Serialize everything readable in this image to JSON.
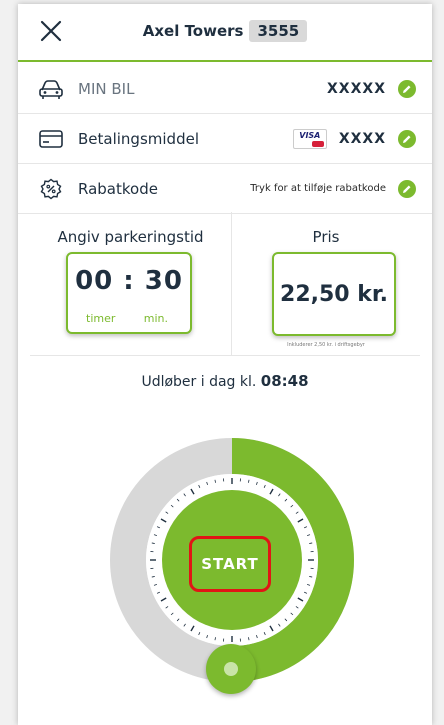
{
  "header": {
    "title": "Axel Towers",
    "zone": "3555",
    "icon": "close-icon"
  },
  "rows": {
    "car": {
      "label": "MIN BIL",
      "value": "XXXXX",
      "icon": "car-icon"
    },
    "payment": {
      "label": "Betalingsmiddel",
      "card_brand": "VISA",
      "value": "XXXX",
      "icon": "credit-card-icon"
    },
    "discount": {
      "label": "Rabatkode",
      "hint": "Tryk for at tilføje rabatkode",
      "icon": "discount-badge-icon"
    }
  },
  "duration": {
    "title": "Angiv parkeringstid",
    "value": "00 : 30",
    "hours_label": "timer",
    "minutes_label": "min."
  },
  "price": {
    "title": "Pris",
    "value": "22,50 kr.",
    "note": "Inkluderer 2,50 kr. i driftsgebyr"
  },
  "expiry": {
    "prefix": "Udløber i dag kl.",
    "time": "08:48"
  },
  "dial": {
    "start_label": "START",
    "progress_fraction": 0.5
  },
  "colors": {
    "accent": "#7cba2e",
    "text": "#1f2f3f",
    "highlight": "#e11515"
  }
}
